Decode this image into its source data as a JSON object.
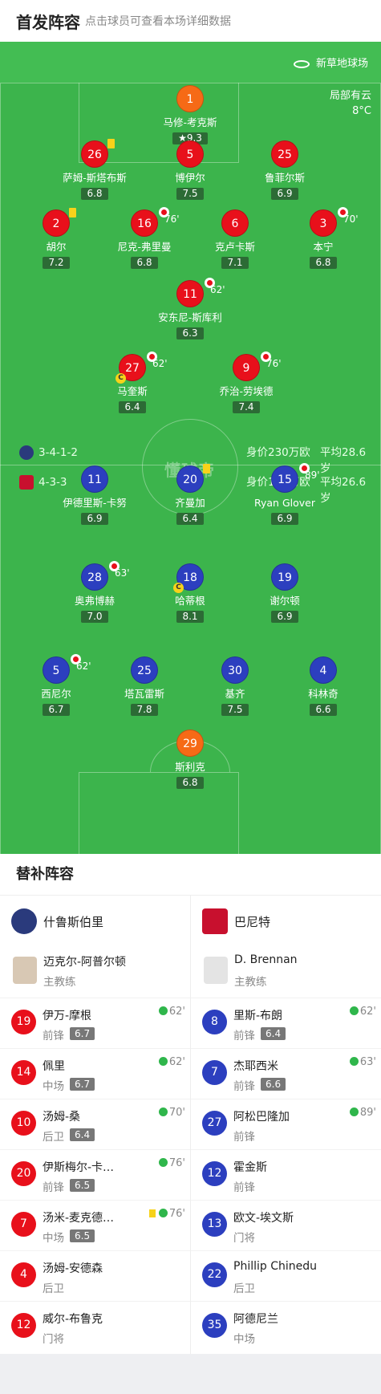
{
  "header": {
    "title": "首发阵容",
    "hint": "点击球员可查看本场详细数据"
  },
  "venue": {
    "stadium": "新草地球场",
    "weather_line1": "局部有云",
    "weather_line2": "8°C"
  },
  "watermark": "懂球帝",
  "home_form": {
    "formation": "3-4-1-2",
    "value": "身价230万欧",
    "avg_age": "平均28.6岁"
  },
  "away_form": {
    "formation": "4-3-3",
    "value": "身价158万欧",
    "avg_age": "平均26.6岁"
  },
  "home_players": [
    {
      "num": "1",
      "name": "马修-考克斯",
      "rating": "9.3",
      "star": true,
      "color": "orange"
    },
    {
      "num": "26",
      "name": "萨姆-斯塔布斯",
      "rating": "6.8",
      "yellow": true,
      "color": "red"
    },
    {
      "num": "5",
      "name": "博伊尔",
      "rating": "7.5",
      "color": "red"
    },
    {
      "num": "25",
      "name": "鲁菲尔斯",
      "rating": "6.9",
      "color": "red"
    },
    {
      "num": "2",
      "name": "胡尔",
      "rating": "7.2",
      "yellow": true,
      "color": "red"
    },
    {
      "num": "16",
      "name": "尼克-弗里曼",
      "rating": "6.8",
      "sub": "76'",
      "color": "red"
    },
    {
      "num": "6",
      "name": "克卢卡斯",
      "rating": "7.1",
      "color": "red"
    },
    {
      "num": "3",
      "name": "本宁",
      "rating": "6.8",
      "sub": "70'",
      "color": "red"
    },
    {
      "num": "11",
      "name": "安东尼-斯库利",
      "rating": "6.3",
      "sub": "62'",
      "color": "red"
    },
    {
      "num": "27",
      "name": "马奎斯",
      "rating": "6.4",
      "sub": "62'",
      "captain": true,
      "color": "red"
    },
    {
      "num": "9",
      "name": "乔治-劳埃德",
      "rating": "7.4",
      "sub": "76'",
      "color": "red"
    }
  ],
  "away_players": [
    {
      "num": "11",
      "name": "伊德里斯-卡努",
      "rating": "6.9",
      "color": "blue"
    },
    {
      "num": "20",
      "name": "齐曼加",
      "rating": "6.4",
      "yellow": true,
      "color": "blue"
    },
    {
      "num": "15",
      "name": "Ryan Glover",
      "rating": "6.9",
      "sub": "89'",
      "color": "blue"
    },
    {
      "num": "28",
      "name": "奥弗博赫",
      "rating": "7.0",
      "sub": "63'",
      "color": "blue"
    },
    {
      "num": "18",
      "name": "哈蒂根",
      "rating": "8.1",
      "captain": true,
      "color": "blue"
    },
    {
      "num": "19",
      "name": "谢尔顿",
      "rating": "6.9",
      "color": "blue"
    },
    {
      "num": "5",
      "name": "西尼尔",
      "rating": "6.7",
      "sub": "62'",
      "color": "blue"
    },
    {
      "num": "25",
      "name": "塔瓦雷斯",
      "rating": "7.8",
      "color": "blue"
    },
    {
      "num": "30",
      "name": "基齐",
      "rating": "7.5",
      "color": "blue"
    },
    {
      "num": "4",
      "name": "科林奇",
      "rating": "6.6",
      "color": "blue"
    },
    {
      "num": "29",
      "name": "斯利克",
      "rating": "6.8",
      "color": "orange"
    }
  ],
  "subs": {
    "title": "替补阵容",
    "home_team": "什鲁斯伯里",
    "away_team": "巴尼特",
    "home_coach": {
      "name": "迈克尔-阿普尔顿",
      "role": "主教练"
    },
    "away_coach": {
      "name": "D. Brennan",
      "role": "主教练"
    },
    "home": [
      {
        "num": "19",
        "name": "伊万-摩根",
        "pos": "前锋",
        "rating": "6.7",
        "in": "62'"
      },
      {
        "num": "14",
        "name": "佩里",
        "pos": "中场",
        "rating": "6.7",
        "in": "62'"
      },
      {
        "num": "10",
        "name": "汤姆-桑",
        "pos": "后卫",
        "rating": "6.4",
        "in": "70'"
      },
      {
        "num": "20",
        "name": "伊斯梅尔-卡…",
        "pos": "前锋",
        "rating": "6.5",
        "in": "76'"
      },
      {
        "num": "7",
        "name": "汤米-麦克德…",
        "pos": "中场",
        "rating": "6.5",
        "in": "76'",
        "yellow": true
      },
      {
        "num": "4",
        "name": "汤姆-安德森",
        "pos": "后卫",
        "rating": "",
        "in": ""
      },
      {
        "num": "12",
        "name": "威尔-布鲁克",
        "pos": "门将",
        "rating": "",
        "in": ""
      }
    ],
    "away": [
      {
        "num": "8",
        "name": "里斯-布朗",
        "pos": "前锋",
        "rating": "6.4",
        "in": "62'"
      },
      {
        "num": "7",
        "name": "杰耶西米",
        "pos": "前锋",
        "rating": "6.6",
        "in": "63'"
      },
      {
        "num": "27",
        "name": "阿松巴隆加",
        "pos": "前锋",
        "rating": "",
        "in": "89'"
      },
      {
        "num": "12",
        "name": "霍金斯",
        "pos": "前锋",
        "rating": "",
        "in": ""
      },
      {
        "num": "13",
        "name": "欧文-埃文斯",
        "pos": "门将",
        "rating": "",
        "in": ""
      },
      {
        "num": "22",
        "name": "Phillip Chinedu",
        "pos": "后卫",
        "rating": "",
        "in": ""
      },
      {
        "num": "35",
        "name": "阿德尼兰",
        "pos": "中场",
        "rating": "",
        "in": ""
      }
    ]
  }
}
